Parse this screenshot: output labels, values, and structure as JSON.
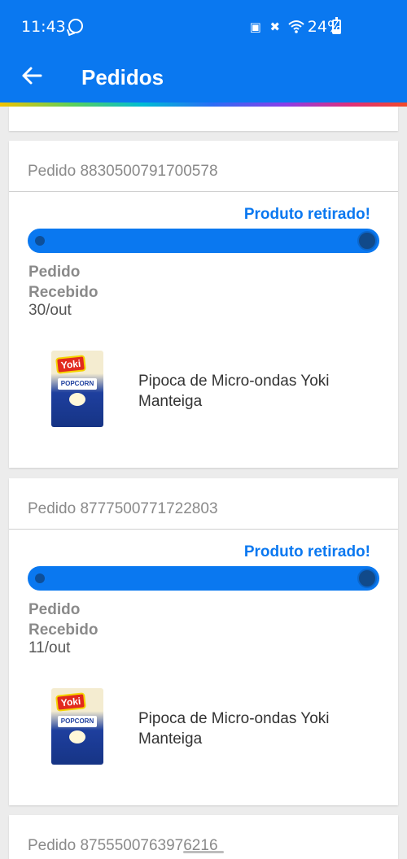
{
  "status_bar": {
    "time": "11:43",
    "battery": "24%",
    "icons": [
      "whatsapp-icon",
      "lock-icon",
      "mute-icon",
      "wifi-icon",
      "battery-icon"
    ]
  },
  "app_bar": {
    "title": "Pedidos",
    "back_icon": "arrow-left-icon",
    "color": "#0a78f0"
  },
  "orders": [
    {
      "label": "Pedido 8830500791700578",
      "status": "Produto retirado!",
      "step_label": "Pedido Recebido",
      "step_date": "30/out",
      "product": {
        "name": "Pipoca de Micro-ondas Yoki Manteiga",
        "image_brand": "Yoki",
        "image_text": "POPCORN MANTEIGA"
      }
    },
    {
      "label": "Pedido 8777500771722803",
      "status": "Produto retirado!",
      "step_label": "Pedido Recebido",
      "step_date": "11/out",
      "product": {
        "name": "Pipoca de Micro-ondas Yoki Manteiga",
        "image_brand": "Yoki",
        "image_text": "POPCORN MANTEIGA"
      }
    },
    {
      "label": "Pedido 8755500763976216"
    }
  ]
}
